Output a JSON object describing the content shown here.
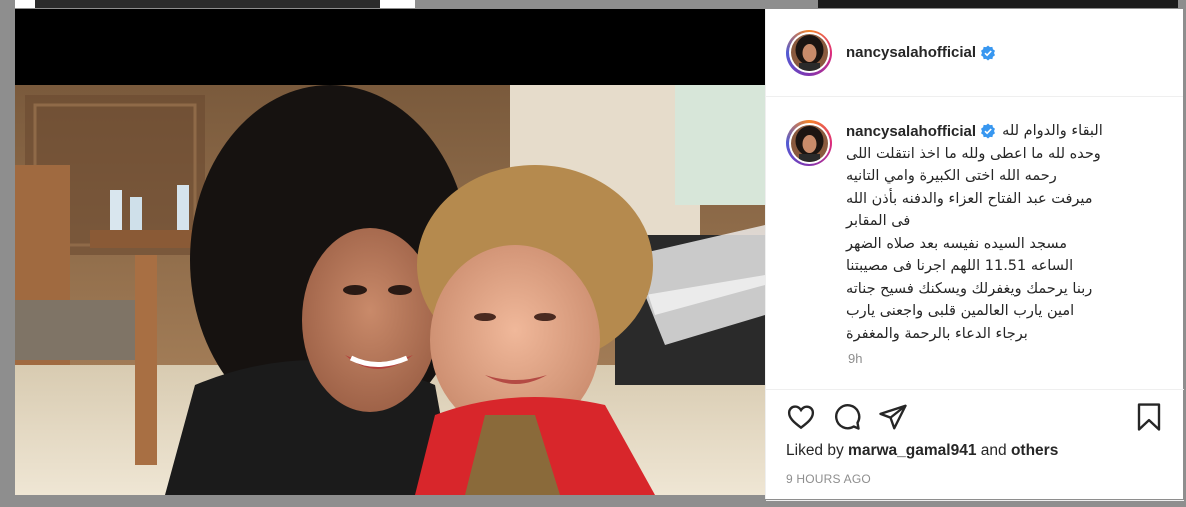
{
  "post": {
    "username": "nancysalahofficial",
    "caption_lines": [
      "البقاء والدوام لله",
      "وحده لله ما اعطى ولله ما اخذ انتقلت اللى",
      "رحمه الله اختى الكبيرة وامي التانيه",
      "ميرفت عبد الفتاح العزاء والدفنه بأذن الله",
      "فى المقابر",
      "مسجد السيده نفيسه بعد صلاه الضهر",
      "الساعه 11.51 اللهم اجرنا فى مصيبتنا",
      "ربنا يرحمك ويغفرلك ويسكنك فسيح جناته",
      "امين يارب العالمين قلبى واجعنى يارب",
      "برجاء الدعاء بالرحمة والمغفرة"
    ],
    "caption_time": "9h",
    "liked_prefix": "Liked by",
    "liked_user": "marwa_gamal941",
    "liked_and": "and",
    "liked_others": "others",
    "timestamp": "9 HOURS AGO"
  },
  "icons": {
    "verified": "verified-badge-icon",
    "like": "heart-icon",
    "comment": "comment-bubble-icon",
    "share": "paper-plane-icon",
    "save": "bookmark-icon"
  },
  "colors": {
    "verified_blue": "#3897f0",
    "text": "#262626",
    "muted": "#8e8e8e"
  }
}
